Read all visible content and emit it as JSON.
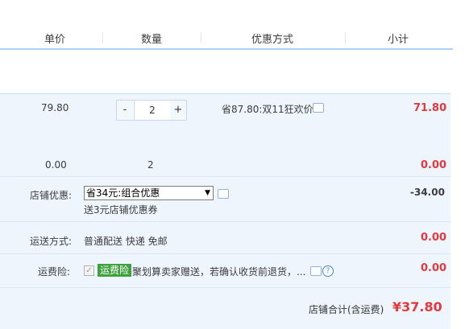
{
  "header": {
    "col_unit_price": "单价",
    "col_quantity": "数量",
    "col_promotion": "优惠方式",
    "col_subtotal": "小计"
  },
  "item": {
    "unit_price": "79.80",
    "quantity_minus": "-",
    "quantity_value": "2",
    "quantity_plus": "+",
    "promotion": "省87.80:双11狂欢价",
    "subtotal": "71.80",
    "sub_price": "0.00",
    "sub_quantity": "2",
    "sub_subtotal": "0.00"
  },
  "shop": {
    "discount_label": "店铺优惠:",
    "discount_select": "省34元:组合优惠",
    "discount_note": "送3元店铺优惠券",
    "discount_value": "-34.00",
    "shipping_label": "运送方式:",
    "shipping_method": "普通配送 快递 免邮",
    "shipping_value": "0.00",
    "insurance_label": "运费险:",
    "insurance_tag": "运费险",
    "insurance_text": "聚划算卖家赠送，若确认收货前退货，...",
    "insurance_value": "0.00",
    "total_label": "店铺合计(含运费)",
    "total_value": "¥37.80"
  },
  "colors": {
    "accent_red": "#e4393c",
    "row_bg": "#eef5fd",
    "header_line": "#b2d1ff",
    "tag_green": "#3ea13e"
  }
}
